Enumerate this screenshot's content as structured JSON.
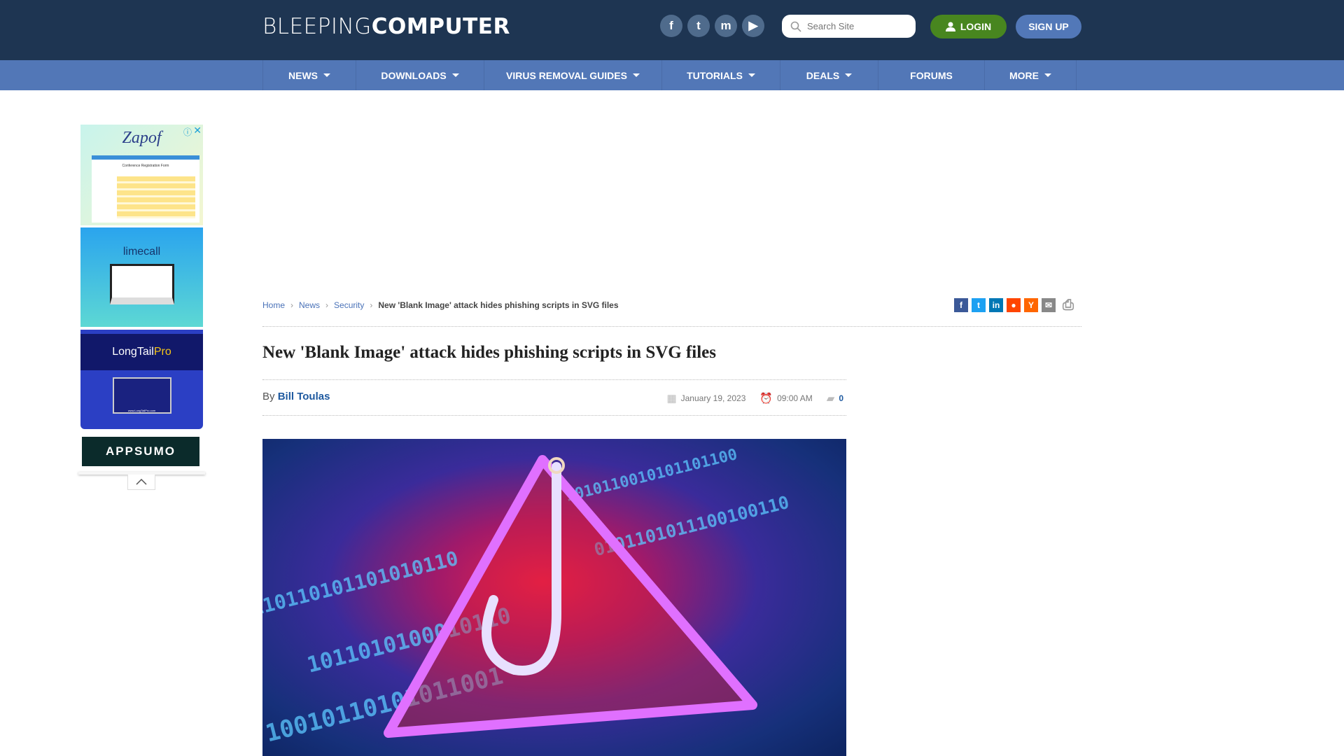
{
  "header": {
    "logo_light": "BLEEPING",
    "logo_bold": "COMPUTER",
    "social": [
      {
        "icon": "facebook-icon",
        "glyph": "f"
      },
      {
        "icon": "twitter-icon",
        "glyph": "t"
      },
      {
        "icon": "mastodon-icon",
        "glyph": "m"
      },
      {
        "icon": "youtube-icon",
        "glyph": "▶"
      }
    ],
    "search_placeholder": "Search Site",
    "login": "LOGIN",
    "signup": "SIGN UP"
  },
  "nav": [
    {
      "label": "NEWS",
      "caret": true
    },
    {
      "label": "DOWNLOADS",
      "caret": true
    },
    {
      "label": "VIRUS REMOVAL GUIDES",
      "caret": true
    },
    {
      "label": "TUTORIALS",
      "caret": true
    },
    {
      "label": "DEALS",
      "caret": true
    },
    {
      "label": "FORUMS",
      "caret": false
    },
    {
      "label": "MORE",
      "caret": true
    }
  ],
  "ads": {
    "zapof": "Zapof",
    "zapof_form": "Conference Registration Form",
    "limecall": "limecall",
    "longtail_a": "LongTail",
    "longtail_b": "Pro",
    "longtail_url": "www.LongTailPro.com",
    "appsumo": "APPSUMO"
  },
  "breadcrumb": {
    "home": "Home",
    "news": "News",
    "security": "Security",
    "current": "New 'Blank Image' attack hides phishing scripts in SVG files"
  },
  "share": [
    {
      "icon": "facebook-share-icon",
      "glyph": "f",
      "color": "#3b5998"
    },
    {
      "icon": "twitter-share-icon",
      "glyph": "t",
      "color": "#1da1f2"
    },
    {
      "icon": "linkedin-share-icon",
      "glyph": "in",
      "color": "#0077b5"
    },
    {
      "icon": "reddit-share-icon",
      "glyph": "●",
      "color": "#ff4500"
    },
    {
      "icon": "hackernews-share-icon",
      "glyph": "Y",
      "color": "#ff6600"
    },
    {
      "icon": "email-share-icon",
      "glyph": "✉",
      "color": "#888888"
    },
    {
      "icon": "print-icon",
      "glyph": "⎙",
      "color": "#999999"
    }
  ],
  "article": {
    "title": "New 'Blank Image' attack hides phishing scripts in SVG files",
    "by": "By",
    "author": "Bill Toulas",
    "date": "January 19, 2023",
    "time": "09:00 AM",
    "comments": "0",
    "hero_digits": [
      "1010110010101101100",
      "0101101011100100110",
      "110110101101010110",
      "1011010100010110",
      "10010110101011001"
    ]
  }
}
